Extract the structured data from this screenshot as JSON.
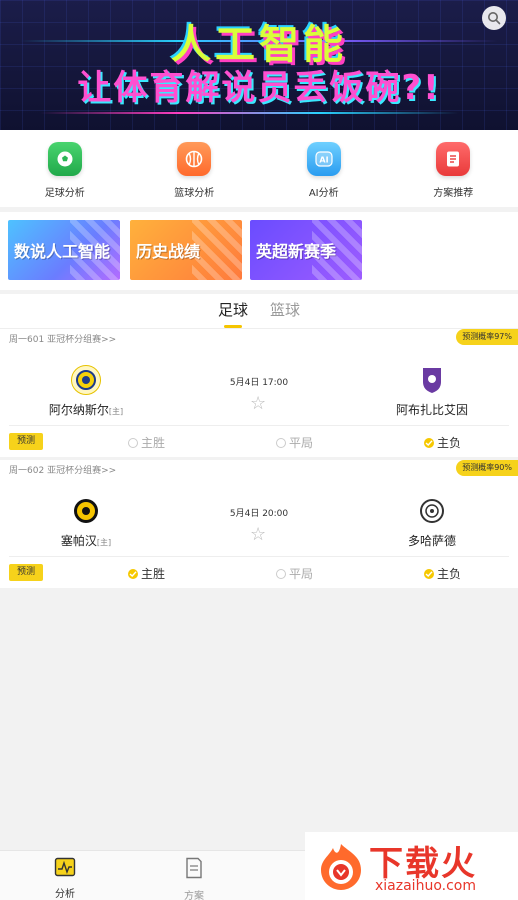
{
  "banner": {
    "title_line1": "人工智能",
    "title_line2": "让体育解说员丢饭碗?!"
  },
  "quicknav": [
    {
      "label": "足球分析",
      "icon": "football-icon",
      "color": "#2fc05a"
    },
    {
      "label": "篮球分析",
      "icon": "basketball-icon",
      "color": "#ff7a3c"
    },
    {
      "label": "AI分析",
      "icon": "ai-icon",
      "color": "#3fb6ff"
    },
    {
      "label": "方案推荐",
      "icon": "document-icon",
      "color": "#f24b4b"
    }
  ],
  "promos": [
    "数说人工智能",
    "历史战绩",
    "英超新赛季"
  ],
  "tabs": [
    {
      "label": "足球",
      "active": true
    },
    {
      "label": "篮球",
      "active": false
    }
  ],
  "matches": [
    {
      "code": "周一601",
      "league": "亚冠杯分组赛>>",
      "probability": "预测概率97%",
      "time": "5月4日 17:00",
      "home": {
        "name": "阿尔纳斯尔",
        "tag": "[主]"
      },
      "away": {
        "name": "阿布扎比艾因"
      },
      "predict_label": "预测",
      "options": [
        {
          "label": "主胜",
          "selected": false
        },
        {
          "label": "平局",
          "selected": false
        },
        {
          "label": "主负",
          "selected": true
        }
      ]
    },
    {
      "code": "周一602",
      "league": "亚冠杯分组赛>>",
      "probability": "预测概率90%",
      "time": "5月4日 20:00",
      "home": {
        "name": "塞帕汉",
        "tag": "[主]"
      },
      "away": {
        "name": "多哈萨德"
      },
      "predict_label": "预测",
      "options": [
        {
          "label": "主胜",
          "selected": true
        },
        {
          "label": "平局",
          "selected": false
        },
        {
          "label": "主负",
          "selected": true
        }
      ]
    }
  ],
  "bottomnav": [
    {
      "label": "分析",
      "icon": "chart-icon",
      "active": true
    },
    {
      "label": "方案",
      "icon": "document-icon",
      "active": false
    }
  ],
  "watermark": {
    "brand": "下载火",
    "url": "xiazaihuo.com"
  },
  "colors": {
    "accent": "#f6d21b",
    "brand_red": "#e8362a"
  }
}
